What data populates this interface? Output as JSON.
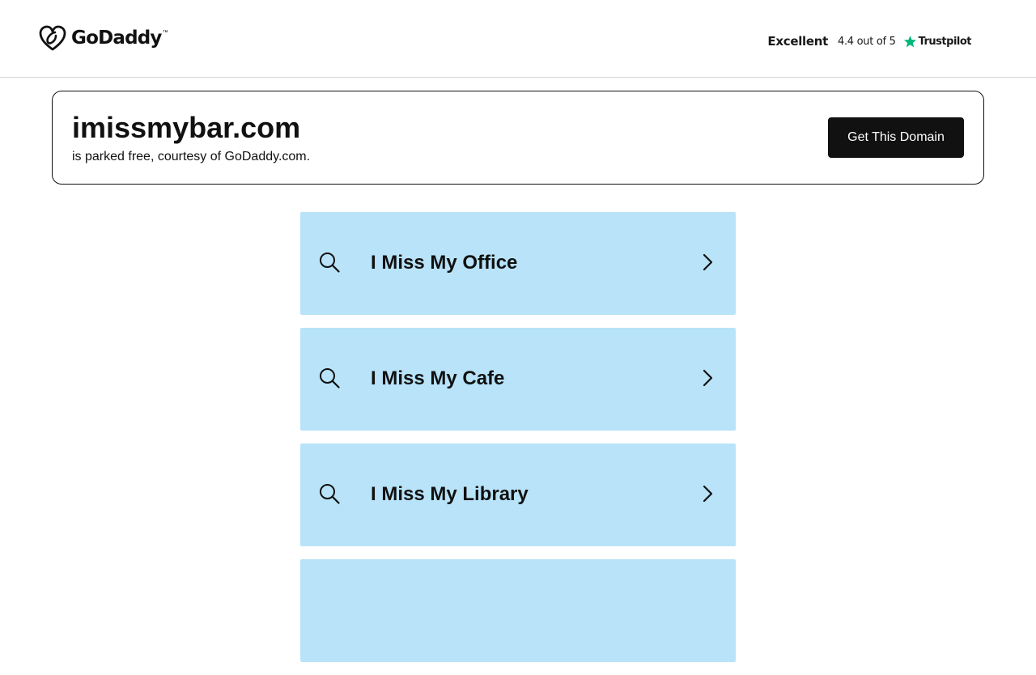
{
  "header": {
    "logo_text": "GoDaddy",
    "logo_tm": "™",
    "trustpilot": {
      "rating_word": "Excellent",
      "score_text": "4.4 out of 5",
      "brand": "Trustpilot",
      "star_color": "#00b67a"
    }
  },
  "domain": {
    "name": "imissmybar.com",
    "subtitle": "is parked free, courtesy of GoDaddy.com.",
    "cta_label": "Get This Domain"
  },
  "results": [
    {
      "label": "I Miss My Office"
    },
    {
      "label": "I Miss My Cafe"
    },
    {
      "label": "I Miss My Library"
    },
    {
      "label": ""
    }
  ],
  "colors": {
    "result_bg": "#b8e3f9",
    "button_bg": "#111111",
    "text": "#111111"
  }
}
